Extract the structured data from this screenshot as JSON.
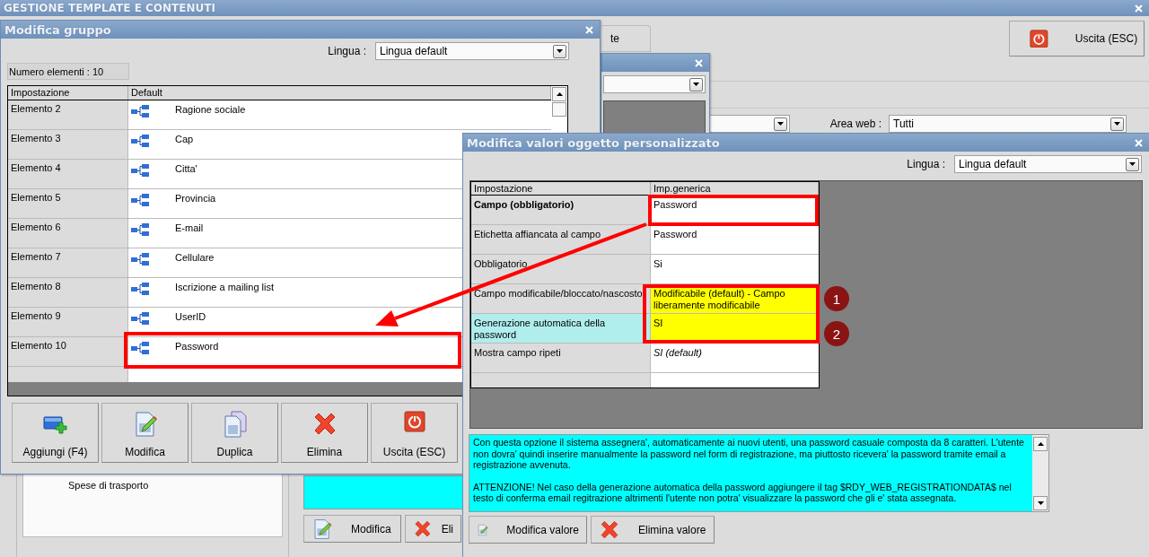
{
  "main_window": {
    "title": "GESTIONE TEMPLATE E CONTENUTI",
    "exit_button": "Uscita (ESC)",
    "tab_partial": "te",
    "area_web": {
      "label": "Area web :",
      "value": "Tutti"
    },
    "tree": {
      "items": [
        "Spese di trasporto"
      ]
    },
    "buttons": [
      {
        "label": "Modifica",
        "kind": "edit"
      },
      {
        "label": "Eli",
        "kind": "delete"
      }
    ]
  },
  "group_dialog": {
    "title": "Modifica gruppo",
    "language": {
      "label": "Lingua :",
      "value": "Lingua default"
    },
    "count": "Numero elementi : 10",
    "table": {
      "columns": [
        "Impostazione",
        "Default"
      ],
      "rows": [
        {
          "setting": "Elemento 2",
          "value": "Ragione sociale"
        },
        {
          "setting": "Elemento 3",
          "value": "Cap"
        },
        {
          "setting": "Elemento 4",
          "value": "Citta'"
        },
        {
          "setting": "Elemento 5",
          "value": "Provincia"
        },
        {
          "setting": "Elemento 6",
          "value": "E-mail"
        },
        {
          "setting": "Elemento 7",
          "value": "Cellulare"
        },
        {
          "setting": "Elemento 8",
          "value": "Iscrizione a mailing list"
        },
        {
          "setting": "Elemento 9",
          "value": "UserID"
        },
        {
          "setting": "Elemento 10",
          "value": "Password"
        }
      ]
    },
    "buttons": [
      {
        "label": "Aggiungi (F4)",
        "kind": "add"
      },
      {
        "label": "Modifica",
        "kind": "edit"
      },
      {
        "label": "Duplica",
        "kind": "duplicate"
      },
      {
        "label": "Elimina",
        "kind": "delete"
      },
      {
        "label": "Uscita (ESC)",
        "kind": "exit"
      }
    ]
  },
  "value_dialog": {
    "title": "Modifica valori oggetto personalizzato",
    "language": {
      "label": "Lingua :",
      "value": "Lingua default"
    },
    "table": {
      "columns": [
        "Impostazione",
        "Imp.generica"
      ],
      "rows": [
        {
          "setting": "Campo (obbligatorio)",
          "value": "Password",
          "required": true,
          "default_value": false,
          "selected": false,
          "highlighted": false
        },
        {
          "setting": "Etichetta affiancata al campo",
          "value": "Password",
          "required": false,
          "default_value": false,
          "selected": false,
          "highlighted": false
        },
        {
          "setting": "Obbligatorio",
          "value": "Si",
          "required": false,
          "default_value": false,
          "selected": false,
          "highlighted": false
        },
        {
          "setting": "Campo modificabile/bloccato/nascosto",
          "value": "Modificabile (default) - Campo liberamente modificabile",
          "required": false,
          "default_value": false,
          "selected": false,
          "highlighted": true
        },
        {
          "setting": "Generazione automatica della password",
          "value": "SI",
          "required": false,
          "default_value": false,
          "selected": true,
          "highlighted": true
        },
        {
          "setting": "Mostra campo ripeti",
          "value": "SI (default)",
          "required": false,
          "default_value": true,
          "selected": false,
          "highlighted": false
        }
      ]
    },
    "description": [
      "Con questa opzione il sistema assegnera', automaticamente ai nuovi utenti, una password casuale composta da 8 caratteri. L'utente non dovra' quindi inserire manualmente la password nel form di registrazione, ma piuttosto ricevera' la password tramite email a registrazione avvenuta.",
      "ATTENZIONE! Nel caso della generazione automatica della password aggiungere il tag $RDY_WEB_REGISTRATIONDATA$ nel testo di conferma email regitrazione altrimenti l'utente non potra' visualizzare la password che gli e' stata assegnata."
    ],
    "buttons": [
      {
        "label": "Modifica valore",
        "kind": "edit"
      },
      {
        "label": "Elimina valore",
        "kind": "delete"
      }
    ]
  },
  "annotations": {
    "markers": [
      {
        "number": "1"
      },
      {
        "number": "2"
      }
    ]
  }
}
